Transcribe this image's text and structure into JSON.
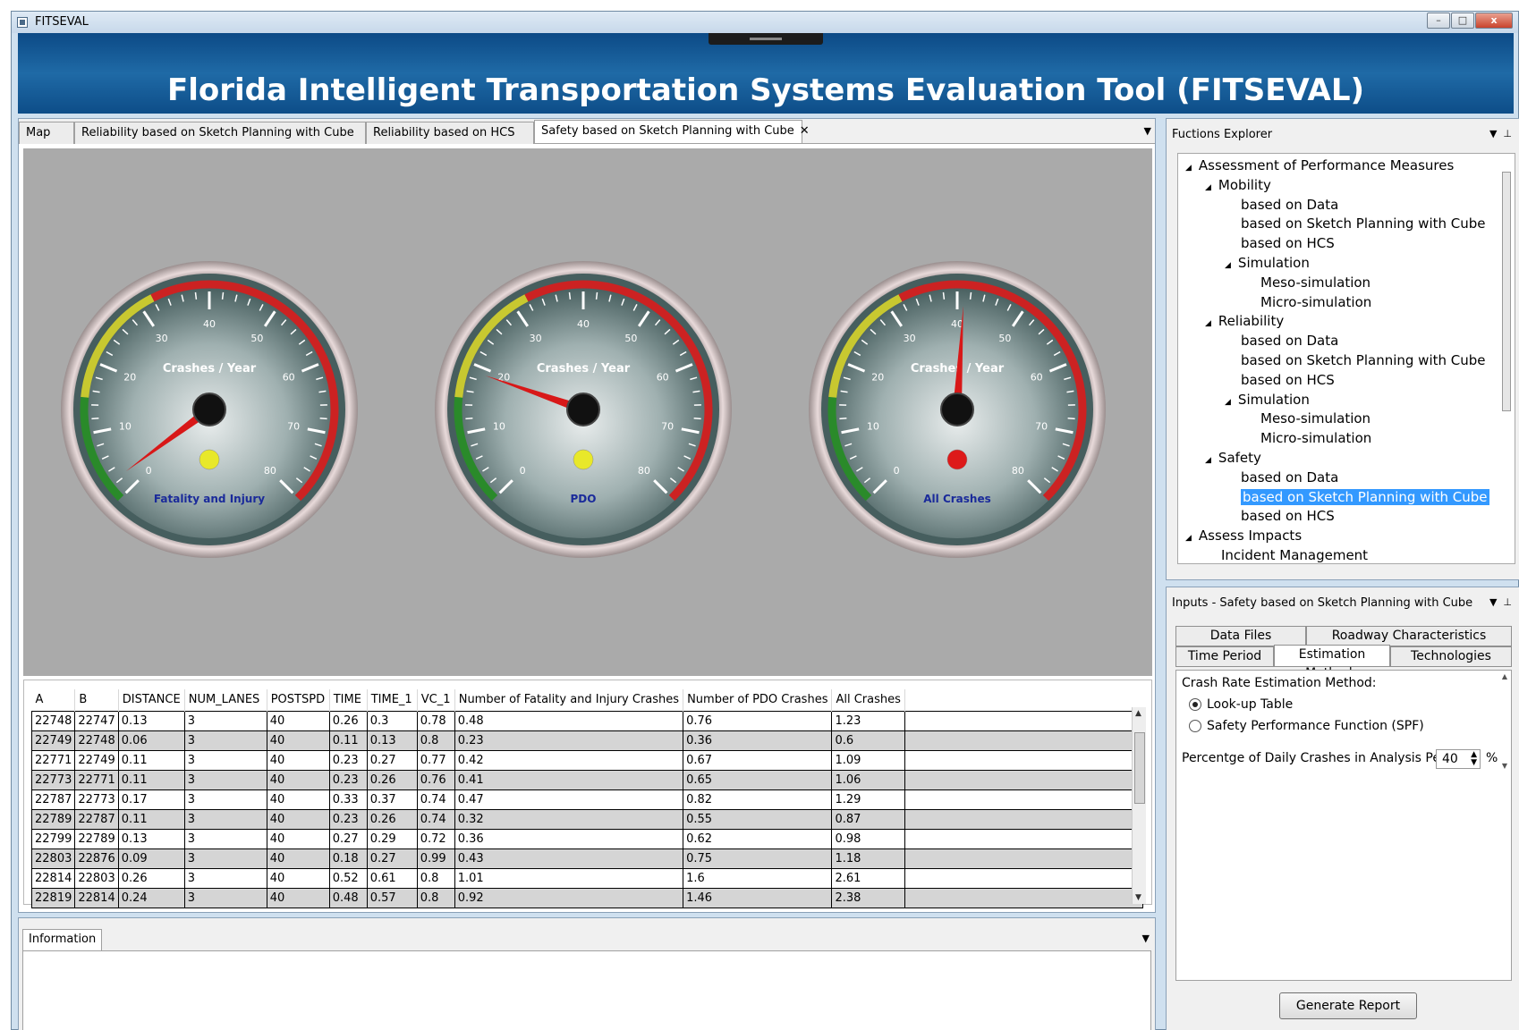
{
  "window": {
    "title": "FITSEVAL",
    "buttons": [
      "–",
      "□",
      "x"
    ]
  },
  "banner": {
    "title": "Florida Intelligent Transportation Systems Evaluation Tool (FITSEVAL)"
  },
  "tabs": [
    {
      "label": "Map"
    },
    {
      "label": "Reliability based on Sketch Planning with Cube"
    },
    {
      "label": "Reliability based on HCS"
    },
    {
      "label": "Safety based on Sketch Planning with Cube",
      "close": "✕",
      "active": true
    }
  ],
  "gauges": [
    {
      "title": "Crashes / Year",
      "label": "Fatality and Injury",
      "value": 2.5,
      "indicator_color": "#e8e82a",
      "ticks": [
        "0",
        "10",
        "20",
        "30",
        "40",
        "50",
        "60",
        "70",
        "80"
      ]
    },
    {
      "title": "Crashes / Year",
      "label": "PDO",
      "value": 19,
      "indicator_color": "#e8e82a",
      "ticks": [
        "0",
        "10",
        "20",
        "30",
        "40",
        "50",
        "60",
        "70",
        "80"
      ]
    },
    {
      "title": "Crashes / Year",
      "label": "All Crashes",
      "value": 41,
      "indicator_color": "#dd1a1a",
      "ticks": [
        "0",
        "10",
        "20",
        "30",
        "40",
        "50",
        "60",
        "70",
        "80"
      ]
    }
  ],
  "table": {
    "columns": [
      "A",
      "B",
      "DISTANCE",
      "NUM_LANES",
      "POSTSPD",
      "TIME",
      "TIME_1",
      "VC_1",
      "Number of Fatality and Injury Crashes",
      "Number of PDO Crashes",
      "All Crashes"
    ],
    "rows": [
      [
        "22748",
        "22747",
        "0.13",
        "3",
        "40",
        "0.26",
        "0.3",
        "0.78",
        "0.48",
        "0.76",
        "1.23"
      ],
      [
        "22749",
        "22748",
        "0.06",
        "3",
        "40",
        "0.11",
        "0.13",
        "0.8",
        "0.23",
        "0.36",
        "0.6"
      ],
      [
        "22771",
        "22749",
        "0.11",
        "3",
        "40",
        "0.23",
        "0.27",
        "0.77",
        "0.42",
        "0.67",
        "1.09"
      ],
      [
        "22773",
        "22771",
        "0.11",
        "3",
        "40",
        "0.23",
        "0.26",
        "0.76",
        "0.41",
        "0.65",
        "1.06"
      ],
      [
        "22787",
        "22773",
        "0.17",
        "3",
        "40",
        "0.33",
        "0.37",
        "0.74",
        "0.47",
        "0.82",
        "1.29"
      ],
      [
        "22789",
        "22787",
        "0.11",
        "3",
        "40",
        "0.23",
        "0.26",
        "0.74",
        "0.32",
        "0.55",
        "0.87"
      ],
      [
        "22799",
        "22789",
        "0.13",
        "3",
        "40",
        "0.27",
        "0.29",
        "0.72",
        "0.36",
        "0.62",
        "0.98"
      ],
      [
        "22803",
        "22876",
        "0.09",
        "3",
        "40",
        "0.18",
        "0.27",
        "0.99",
        "0.43",
        "0.75",
        "1.18"
      ],
      [
        "22814",
        "22803",
        "0.26",
        "3",
        "40",
        "0.52",
        "0.61",
        "0.8",
        "1.01",
        "1.6",
        "2.61"
      ],
      [
        "22819",
        "22814",
        "0.24",
        "3",
        "40",
        "0.48",
        "0.57",
        "0.8",
        "0.92",
        "1.46",
        "2.38"
      ]
    ]
  },
  "info": {
    "tab_label": "Information"
  },
  "explorer": {
    "title": "Fuctions Explorer",
    "items": [
      {
        "label": "Assessment of Performance Measures",
        "level": 0,
        "caret": "◢"
      },
      {
        "label": "Mobility",
        "level": 1,
        "caret": "◢"
      },
      {
        "label": "based on Data",
        "level": 2
      },
      {
        "label": "based on Sketch Planning with Cube",
        "level": 2
      },
      {
        "label": "based on HCS",
        "level": 2
      },
      {
        "label": "Simulation",
        "level": 2,
        "caret": "◢"
      },
      {
        "label": "Meso-simulation",
        "level": 3
      },
      {
        "label": "Micro-simulation",
        "level": 3
      },
      {
        "label": "Reliability",
        "level": 1,
        "caret": "◢"
      },
      {
        "label": "based on Data",
        "level": 2
      },
      {
        "label": "based on Sketch Planning with Cube",
        "level": 2
      },
      {
        "label": "based on HCS",
        "level": 2
      },
      {
        "label": "Simulation",
        "level": 2,
        "caret": "◢"
      },
      {
        "label": "Meso-simulation",
        "level": 3
      },
      {
        "label": "Micro-simulation",
        "level": 3
      },
      {
        "label": "Safety",
        "level": 1,
        "caret": "◢"
      },
      {
        "label": "based on Data",
        "level": 2
      },
      {
        "label": "based on Sketch Planning with Cube",
        "level": 2,
        "selected": true
      },
      {
        "label": "based on HCS",
        "level": 2
      },
      {
        "label": "Assess Impacts",
        "level": 0,
        "caret": "◢"
      },
      {
        "label": "Incident Management",
        "level": 1
      }
    ]
  },
  "inputs": {
    "title": "Inputs - Safety based on Sketch Planning with Cube",
    "tabs_row1": [
      "Data Files",
      "Roadway Characteristics"
    ],
    "tabs_row2": [
      "Time Period",
      "Estimation Methods",
      "Technologies"
    ],
    "active_tab": "Estimation Methods",
    "method_label": "Crash Rate Estimation Method:",
    "options": [
      {
        "label": "Look-up Table",
        "checked": true
      },
      {
        "label": "Safety Performance Function (SPF)",
        "checked": false
      }
    ],
    "percent_label": "Percentge of Daily Crashes in Analysis Period:",
    "percent_value": "40",
    "percent_unit": "%",
    "generate_button": "Generate Report"
  }
}
